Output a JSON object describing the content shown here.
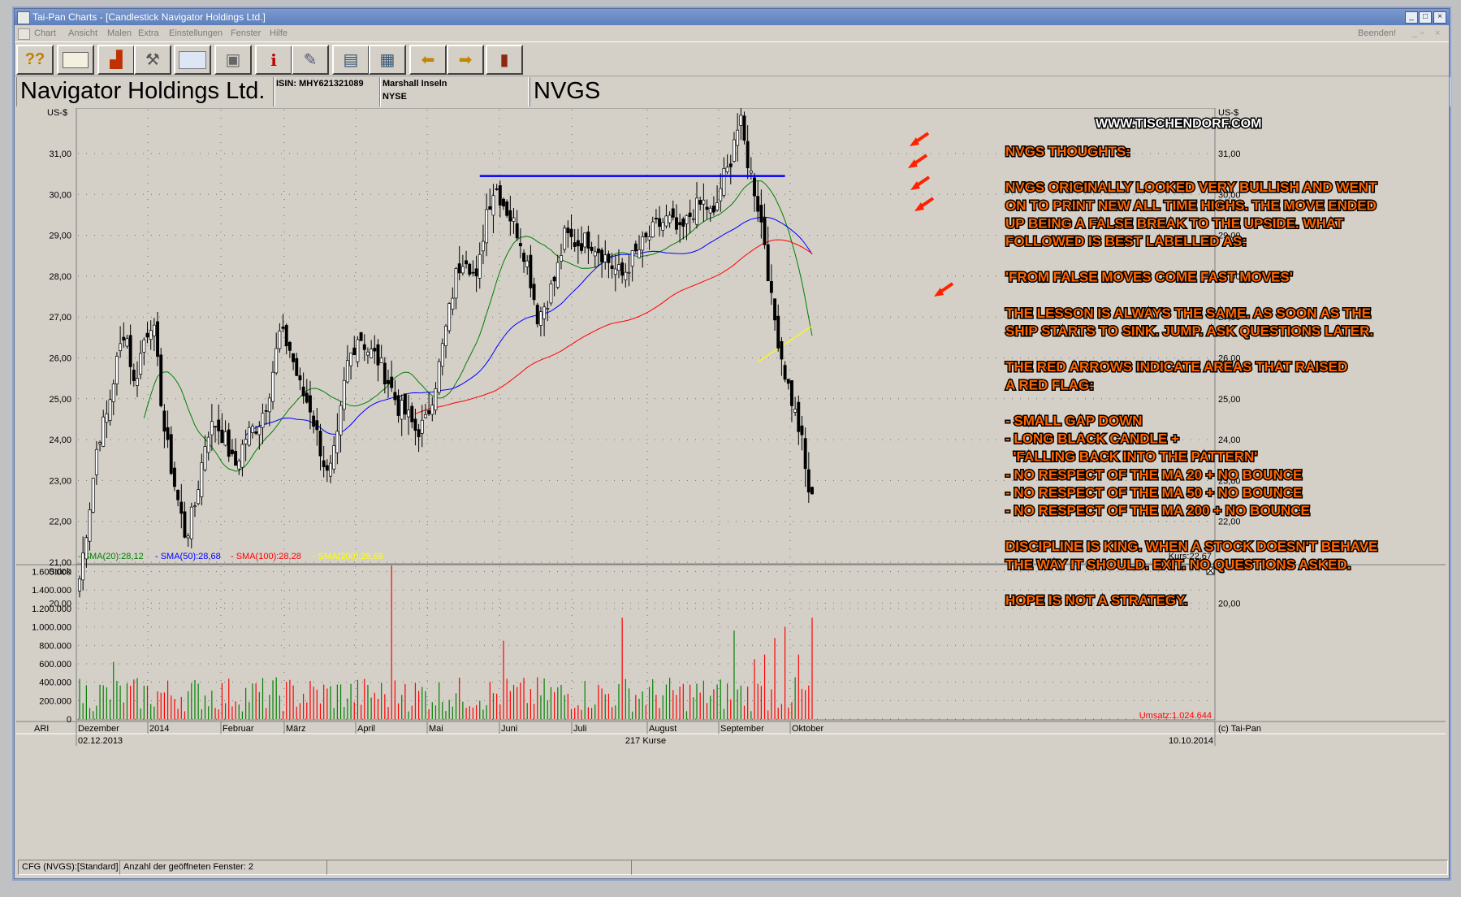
{
  "window": {
    "title": "Tai-Pan  Charts - [Candlestick Navigator Holdings Ltd.]"
  },
  "menu": {
    "items": [
      "Chart",
      "Ansicht",
      "Malen",
      "Extra",
      "Einstellungen",
      "Fenster",
      "Hilfe"
    ],
    "end_label": "Beenden!"
  },
  "toolbar": {
    "buttons": [
      "help-icon",
      "book-icon",
      "chart-icon",
      "tools-icon",
      "news-icon",
      "printer-icon",
      "info-icon",
      "pen-icon",
      "monitor-icon",
      "table-icon",
      "back-arrow-icon",
      "forward-arrow-icon",
      "exit-door-icon"
    ]
  },
  "info": {
    "company": "Navigator Holdings Ltd.",
    "isin": "ISIN: MHY621321089",
    "country": "Marshall Inseln",
    "exchange": "NYSE",
    "ticker": "NVGS"
  },
  "chart": {
    "unit_label": "US-$",
    "watermark": "WWW.TISCHENDORF.COM",
    "y_ticks": [
      "31,00",
      "30,00",
      "29,00",
      "28,00",
      "27,00",
      "26,00",
      "25,00",
      "24,00",
      "23,00",
      "22,00",
      "21,00",
      "20,00"
    ],
    "sma_labels": [
      {
        "text": "SMA(20):28,12",
        "color": "#008000"
      },
      {
        "text": "SMA(50):28,68",
        "color": "#0000ff"
      },
      {
        "text": "SMA(100):28,28",
        "color": "#ff0000"
      },
      {
        "text": "SMA(200):26,68",
        "color": "#ffff00"
      }
    ],
    "kurs_label": "Kurs:22,67",
    "volume_label": "Stück",
    "volume_ticks": [
      "1.600.000",
      "1.400.000",
      "1.200.000",
      "1.000.000",
      "800.000",
      "600.000",
      "400.000",
      "200.000",
      "0"
    ],
    "umsatz_label": "Umsatz:1.024.644",
    "months": [
      "Dezember",
      "2014",
      "Februar",
      "März",
      "April",
      "Mai",
      "Juni",
      "Juli",
      "August",
      "September",
      "Oktober"
    ],
    "ari_label": "ARI",
    "copyright": "(c) Tai-Pan",
    "start_date": "02.12.2013",
    "count_label": "217 Kurse",
    "end_date": "10.10.2014",
    "annotation_color": "#ff6600",
    "annotations": [
      "NVGS THOUGHTS:",
      "",
      "NVGS ORIGINALLY LOOKED VERY BULLISH AND WENT",
      "ON TO PRINT NEW ALL TIME HIGHS. THE MOVE ENDED",
      "UP BEING A FALSE BREAK TO THE UPSIDE. WHAT",
      "FOLLOWED IS BEST LABELLED AS:",
      "",
      "'FROM FALSE MOVES COME FAST MOVES'",
      "",
      "THE LESSON IS ALWAYS THE SAME. AS SOON AS THE",
      "SHIP STARTS TO SINK. JUMP. ASK QUESTIONS LATER.",
      "",
      "THE RED ARROWS INDICATE AREAS THAT RAISED",
      "A RED FLAG:",
      "",
      "- SMALL GAP DOWN",
      "- LONG BLACK CANDLE +",
      "  'FALLING BACK INTO THE PATTERN'",
      "- NO RESPECT OF THE MA 20 + NO BOUNCE",
      "- NO RESPECT OF THE MA 50 + NO BOUNCE",
      "- NO RESPECT OF THE MA 200 + NO BOUNCE",
      "",
      "DISCIPLINE IS KING. WHEN A STOCK DOESN'T BEHAVE",
      "THE WAY IT SHOULD. EXIT. NO QUESTIONS ASKED.",
      "",
      "HOPE IS NOT A STRATEGY."
    ]
  },
  "status": {
    "cell1": "CFG (NVGS):[Standard]",
    "cell2": "Anzahl der geöffneten Fenster: 2"
  }
}
